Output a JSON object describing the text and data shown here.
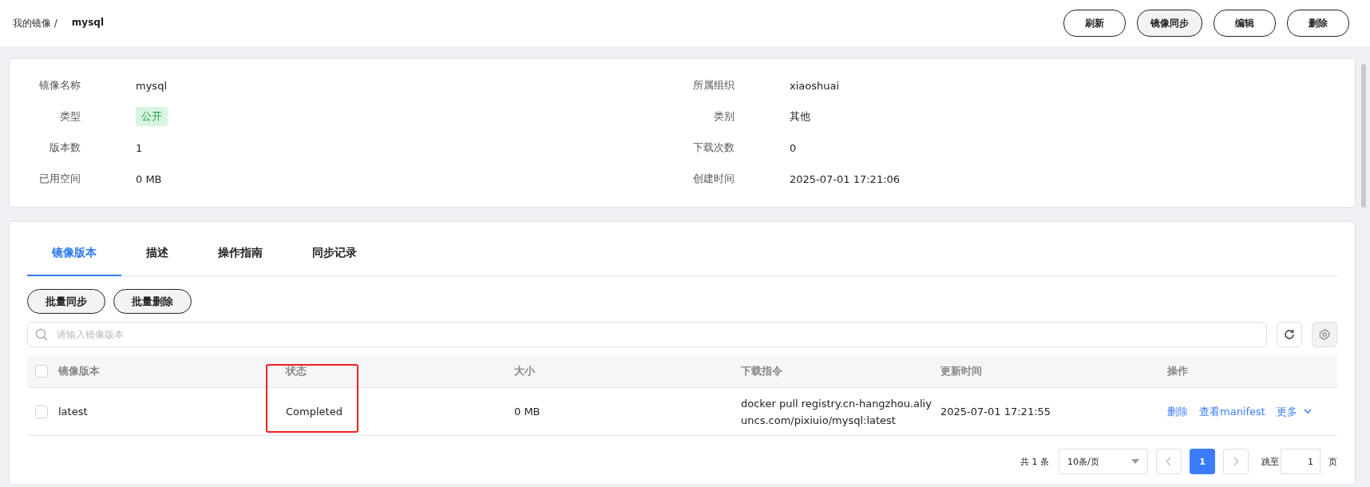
{
  "breadcrumb": {
    "parent": "我的镜像 /",
    "current": "mysql"
  },
  "header_buttons": [
    {
      "label": "刷新",
      "selected": false
    },
    {
      "label": "镜像同步",
      "selected": true
    },
    {
      "label": "编辑",
      "selected": false
    },
    {
      "label": "删除",
      "selected": false
    }
  ],
  "info": [
    {
      "label": "镜像名称",
      "value": "mysql",
      "kind": "text"
    },
    {
      "label": "所属组织",
      "value": "xiaoshuai",
      "kind": "text"
    },
    {
      "label": "类型",
      "value": "公开",
      "kind": "tag"
    },
    {
      "label": "类别",
      "value": "其他",
      "kind": "text"
    },
    {
      "label": "版本数",
      "value": "1",
      "kind": "text"
    },
    {
      "label": "下载次数",
      "value": "0",
      "kind": "text"
    },
    {
      "label": "已用空间",
      "value": "0 MB",
      "kind": "text"
    },
    {
      "label": "创建时间",
      "value": "2025-07-01 17:21:06",
      "kind": "text"
    }
  ],
  "tabs": [
    {
      "label": "镜像版本",
      "selected": true
    },
    {
      "label": "描述",
      "selected": false
    },
    {
      "label": "操作指南",
      "selected": false
    },
    {
      "label": "同步记录",
      "selected": false
    }
  ],
  "batch_buttons": [
    "批量同步",
    "批量删除"
  ],
  "search": {
    "placeholder": "请输入镜像版本"
  },
  "table": {
    "header_checked": false,
    "columns": [
      "镜像版本",
      "状态",
      "大小",
      "下载指令",
      "更新时间",
      "操作"
    ],
    "rows": [
      {
        "checked": false,
        "cells": [
          "latest",
          "Completed",
          "0 MB",
          "docker pull registry.cn-hangzhou.aliyuncs.com/pixiuio/mysql:latest",
          "2025-07-01 17:21:55"
        ],
        "actions": [
          {
            "label": "删除",
            "kind": "link"
          },
          {
            "label": "查看manifest",
            "kind": "link"
          },
          {
            "label": "更多",
            "kind": "dropdown"
          }
        ]
      }
    ]
  },
  "pagination": {
    "total": "共 1 条",
    "page_size": "10条/页",
    "pages": [
      {
        "label": "1",
        "selected": true
      }
    ],
    "jump_label": "跳至",
    "jump_value": "1",
    "jump_unit": "页"
  }
}
